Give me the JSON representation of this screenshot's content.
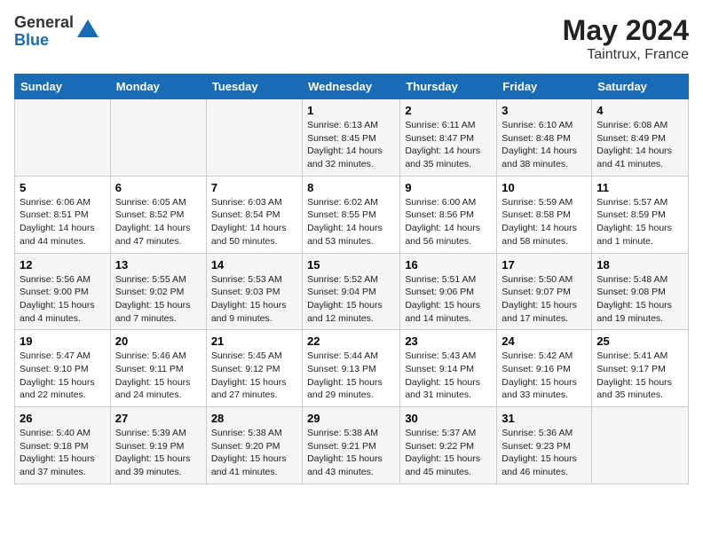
{
  "header": {
    "logo_general": "General",
    "logo_blue": "Blue",
    "month_year": "May 2024",
    "location": "Taintrux, France"
  },
  "weekdays": [
    "Sunday",
    "Monday",
    "Tuesday",
    "Wednesday",
    "Thursday",
    "Friday",
    "Saturday"
  ],
  "weeks": [
    [
      {
        "day": "",
        "info": ""
      },
      {
        "day": "",
        "info": ""
      },
      {
        "day": "",
        "info": ""
      },
      {
        "day": "1",
        "info": "Sunrise: 6:13 AM\nSunset: 8:45 PM\nDaylight: 14 hours\nand 32 minutes."
      },
      {
        "day": "2",
        "info": "Sunrise: 6:11 AM\nSunset: 8:47 PM\nDaylight: 14 hours\nand 35 minutes."
      },
      {
        "day": "3",
        "info": "Sunrise: 6:10 AM\nSunset: 8:48 PM\nDaylight: 14 hours\nand 38 minutes."
      },
      {
        "day": "4",
        "info": "Sunrise: 6:08 AM\nSunset: 8:49 PM\nDaylight: 14 hours\nand 41 minutes."
      }
    ],
    [
      {
        "day": "5",
        "info": "Sunrise: 6:06 AM\nSunset: 8:51 PM\nDaylight: 14 hours\nand 44 minutes."
      },
      {
        "day": "6",
        "info": "Sunrise: 6:05 AM\nSunset: 8:52 PM\nDaylight: 14 hours\nand 47 minutes."
      },
      {
        "day": "7",
        "info": "Sunrise: 6:03 AM\nSunset: 8:54 PM\nDaylight: 14 hours\nand 50 minutes."
      },
      {
        "day": "8",
        "info": "Sunrise: 6:02 AM\nSunset: 8:55 PM\nDaylight: 14 hours\nand 53 minutes."
      },
      {
        "day": "9",
        "info": "Sunrise: 6:00 AM\nSunset: 8:56 PM\nDaylight: 14 hours\nand 56 minutes."
      },
      {
        "day": "10",
        "info": "Sunrise: 5:59 AM\nSunset: 8:58 PM\nDaylight: 14 hours\nand 58 minutes."
      },
      {
        "day": "11",
        "info": "Sunrise: 5:57 AM\nSunset: 8:59 PM\nDaylight: 15 hours\nand 1 minute."
      }
    ],
    [
      {
        "day": "12",
        "info": "Sunrise: 5:56 AM\nSunset: 9:00 PM\nDaylight: 15 hours\nand 4 minutes."
      },
      {
        "day": "13",
        "info": "Sunrise: 5:55 AM\nSunset: 9:02 PM\nDaylight: 15 hours\nand 7 minutes."
      },
      {
        "day": "14",
        "info": "Sunrise: 5:53 AM\nSunset: 9:03 PM\nDaylight: 15 hours\nand 9 minutes."
      },
      {
        "day": "15",
        "info": "Sunrise: 5:52 AM\nSunset: 9:04 PM\nDaylight: 15 hours\nand 12 minutes."
      },
      {
        "day": "16",
        "info": "Sunrise: 5:51 AM\nSunset: 9:06 PM\nDaylight: 15 hours\nand 14 minutes."
      },
      {
        "day": "17",
        "info": "Sunrise: 5:50 AM\nSunset: 9:07 PM\nDaylight: 15 hours\nand 17 minutes."
      },
      {
        "day": "18",
        "info": "Sunrise: 5:48 AM\nSunset: 9:08 PM\nDaylight: 15 hours\nand 19 minutes."
      }
    ],
    [
      {
        "day": "19",
        "info": "Sunrise: 5:47 AM\nSunset: 9:10 PM\nDaylight: 15 hours\nand 22 minutes."
      },
      {
        "day": "20",
        "info": "Sunrise: 5:46 AM\nSunset: 9:11 PM\nDaylight: 15 hours\nand 24 minutes."
      },
      {
        "day": "21",
        "info": "Sunrise: 5:45 AM\nSunset: 9:12 PM\nDaylight: 15 hours\nand 27 minutes."
      },
      {
        "day": "22",
        "info": "Sunrise: 5:44 AM\nSunset: 9:13 PM\nDaylight: 15 hours\nand 29 minutes."
      },
      {
        "day": "23",
        "info": "Sunrise: 5:43 AM\nSunset: 9:14 PM\nDaylight: 15 hours\nand 31 minutes."
      },
      {
        "day": "24",
        "info": "Sunrise: 5:42 AM\nSunset: 9:16 PM\nDaylight: 15 hours\nand 33 minutes."
      },
      {
        "day": "25",
        "info": "Sunrise: 5:41 AM\nSunset: 9:17 PM\nDaylight: 15 hours\nand 35 minutes."
      }
    ],
    [
      {
        "day": "26",
        "info": "Sunrise: 5:40 AM\nSunset: 9:18 PM\nDaylight: 15 hours\nand 37 minutes."
      },
      {
        "day": "27",
        "info": "Sunrise: 5:39 AM\nSunset: 9:19 PM\nDaylight: 15 hours\nand 39 minutes."
      },
      {
        "day": "28",
        "info": "Sunrise: 5:38 AM\nSunset: 9:20 PM\nDaylight: 15 hours\nand 41 minutes."
      },
      {
        "day": "29",
        "info": "Sunrise: 5:38 AM\nSunset: 9:21 PM\nDaylight: 15 hours\nand 43 minutes."
      },
      {
        "day": "30",
        "info": "Sunrise: 5:37 AM\nSunset: 9:22 PM\nDaylight: 15 hours\nand 45 minutes."
      },
      {
        "day": "31",
        "info": "Sunrise: 5:36 AM\nSunset: 9:23 PM\nDaylight: 15 hours\nand 46 minutes."
      },
      {
        "day": "",
        "info": ""
      }
    ]
  ]
}
